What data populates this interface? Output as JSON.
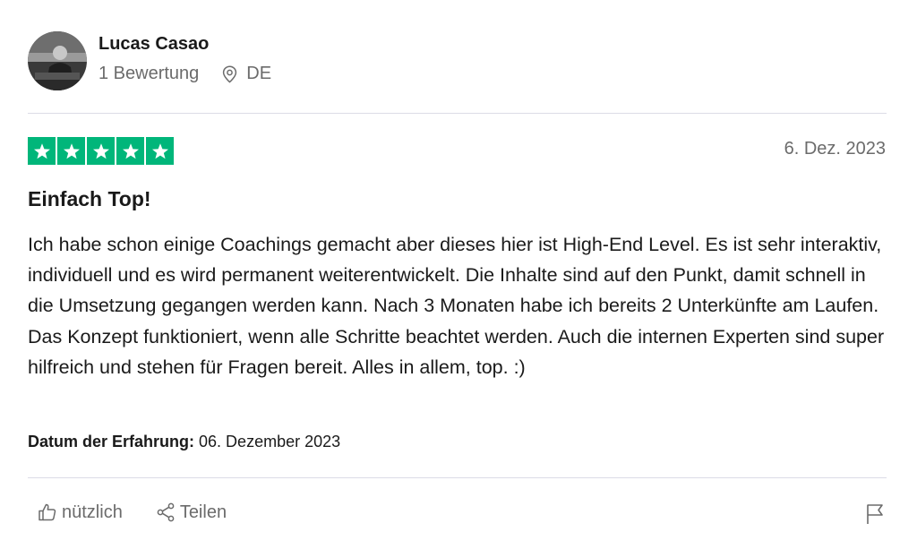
{
  "reviewer": {
    "name": "Lucas Casao",
    "reviews_count": "1 Bewertung",
    "country": "DE"
  },
  "review": {
    "rating": 5,
    "rating_max": 5,
    "star_color": "#00b67a",
    "date": "6. Dez. 2023",
    "title": "Einfach Top!",
    "body": "Ich habe schon einige Coachings gemacht aber dieses hier ist High-End Level. Es ist sehr interaktiv, individuell und es wird permanent weiterentwickelt. Die Inhalte sind auf den Punkt, damit schnell in die Umsetzung gegangen werden kann. Nach 3 Monaten habe ich bereits 2 Unterkünfte am Laufen. Das Konzept funktioniert, wenn alle Schritte beachtet werden. Auch die internen Experten sind super hilfreich und stehen für Fragen bereit. Alles in allem, top. :)",
    "experience_label": "Datum der Erfahrung:",
    "experience_date": "06. Dezember 2023"
  },
  "actions": {
    "useful_label": "nützlich",
    "share_label": "Teilen"
  },
  "icons": {
    "location": "location-pin-icon",
    "useful": "thumbs-up-icon",
    "share": "share-icon",
    "report": "flag-icon"
  }
}
